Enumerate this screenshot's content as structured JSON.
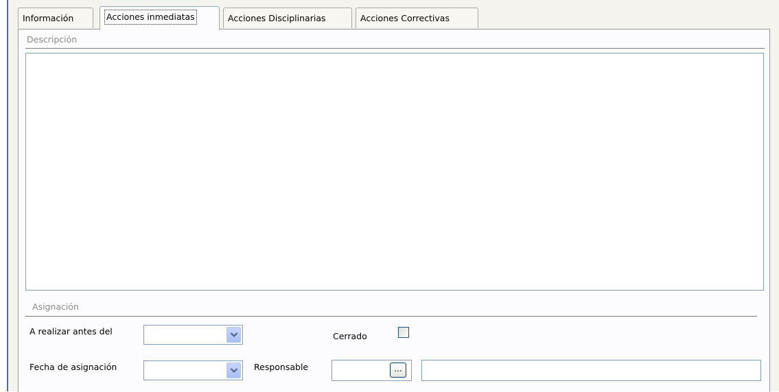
{
  "tabs": [
    {
      "label": "Información",
      "active": false
    },
    {
      "label": "Acciones inmediatas",
      "active": true
    },
    {
      "label": "Acciones Disciplinarias",
      "active": false
    },
    {
      "label": "Acciones Correctivas",
      "active": false
    }
  ],
  "descripcion": {
    "legend": "Descripción",
    "value": ""
  },
  "asignacion": {
    "legend": "Asignación",
    "realizar_label": "A realizar antes del",
    "realizar_value": "",
    "cerrado_label": "Cerrado",
    "cerrado_checked": false,
    "fecha_label": "Fecha de asignación",
    "fecha_value": "",
    "responsable_label": "Responsable",
    "responsable_code": "",
    "responsable_button": "...",
    "responsable_name": ""
  },
  "colors": {
    "tab_border": "#a9a9a2",
    "input_border": "#7f9db9",
    "panel_background": "#f4f3ee"
  }
}
